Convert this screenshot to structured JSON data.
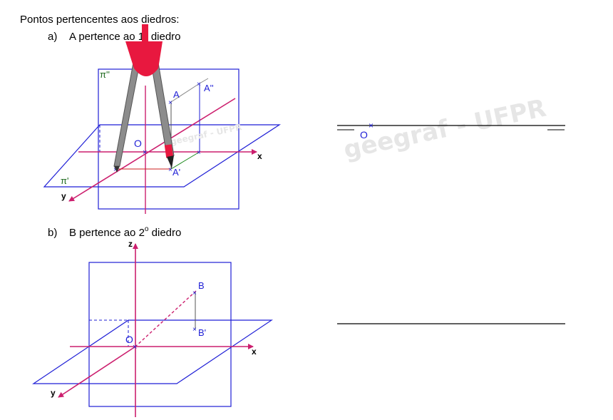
{
  "heading": {
    "title": "Pontos pertencentes aos diedros:",
    "item_a": {
      "marker": "a)",
      "text_before": "A pertence ao 1",
      "degree": "o",
      "text_after": " diedro"
    },
    "item_b": {
      "marker": "b)",
      "text_before": "B pertence ao 2",
      "degree": "o",
      "text_after": " diedro"
    }
  },
  "figure_a": {
    "plane_vertical_label": "π''",
    "plane_horizontal_label": "π'",
    "origin_label": "O",
    "point_label": "A",
    "projection_v_label": "A''",
    "projection_h_label": "A'",
    "axis_x": "x",
    "axis_y": "y",
    "watermark": "geegraf - UFPR",
    "overlay_icon": "compass-drawing-tool-icon"
  },
  "figure_b": {
    "origin_label": "O",
    "point_label": "B",
    "projection_h_label": "B'",
    "axis_x": "x",
    "axis_y": "y",
    "axis_z": "z"
  },
  "epure_a": {
    "origin_label": "O",
    "watermark": "geegraf - UFPR"
  },
  "colors": {
    "plane": "#1f1fd6",
    "axis": "#cc1f6e",
    "compass_body": "#8c8c8c",
    "compass_head": "#e8183f",
    "watermark": "#e6e6e6"
  }
}
